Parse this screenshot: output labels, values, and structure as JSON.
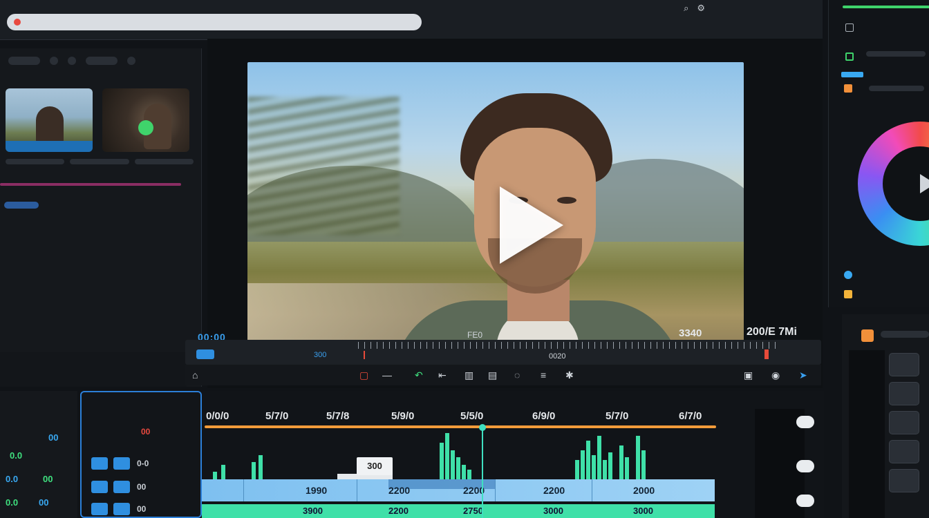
{
  "viewer": {
    "timecode_left": "00:00",
    "timecode_center": "FE0",
    "timecode_right_a": "3340",
    "timecode_right_b": "200/E 7Mi",
    "scrubber_in_label": "300",
    "scrubber_mid_label": "0020"
  },
  "timeline": {
    "ruler": [
      "0/0/0",
      "5/7/0",
      "5/7/8",
      "5/9/0",
      "5/5/0",
      "6/9/0",
      "5/7/0",
      "6/7/0"
    ],
    "clip_label": "300",
    "blue_track": [
      "1990",
      "2200",
      "2200",
      "2200",
      "2000"
    ],
    "green_track": [
      "3900",
      "2200",
      "2750",
      "3000",
      "3000"
    ],
    "waveform_levels": [
      0.15,
      0.3,
      0.35,
      0.5,
      0.75,
      0.95,
      0.6,
      0.45,
      0.3,
      0.2,
      0.4,
      0.6,
      0.8,
      0.5,
      0.9,
      0.4,
      0.55,
      0.7,
      0.45,
      0.9,
      0.6
    ]
  },
  "effects": {
    "labels": [
      "0-0",
      "00",
      "00",
      "00"
    ]
  },
  "bottom_left": {
    "values_green": [
      "0.0",
      "00",
      "0.0"
    ],
    "values_blue": [
      "0.0",
      "00",
      "00"
    ]
  },
  "colors": {
    "accent_blue": "#2f8fe0",
    "waveform_green": "#3fe0a8",
    "timeline_orange": "#f29b3a",
    "record_red": "#e8493f"
  },
  "icons": {
    "play": "play-icon",
    "color_wheel": "color-wheel-icon"
  }
}
